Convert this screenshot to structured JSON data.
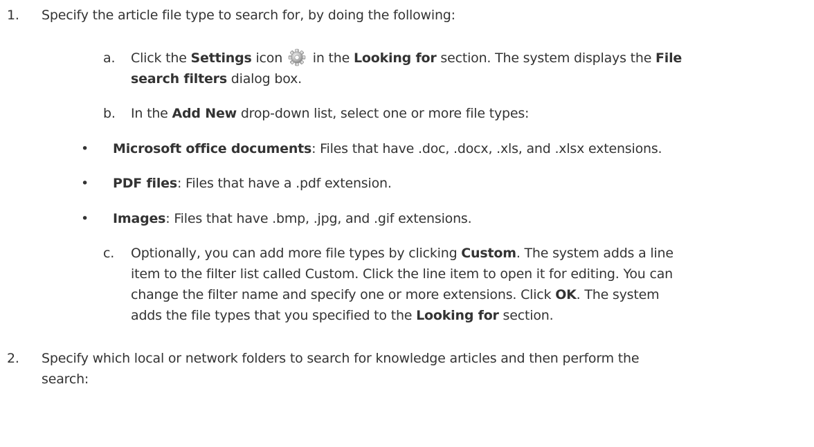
{
  "steps": [
    {
      "number": "1.",
      "text": "Specify the article file type to search for, by doing the following:",
      "substeps": [
        {
          "letter": "a.",
          "line1_pre": "Click the ",
          "settings": "Settings",
          "line1_mid": " icon ",
          "line1_mid2": " in the ",
          "looking_for": "Looking for",
          "line1_post": " section. The system displays the ",
          "file": "File",
          "line2_bold": "search filters",
          "line2_post": " dialog box.",
          "icon": "gear-icon"
        },
        {
          "letter": "b.",
          "pre": "In the ",
          "bold": "Add New",
          "post": " drop-down list, select one or more file types:"
        }
      ],
      "bullets": [
        {
          "bold": "Microsoft office documents",
          "text": ": Files that have .doc, .docx, .xls, and .xlsx extensions."
        },
        {
          "bold": "PDF files",
          "text": ": Files that have a .pdf extension."
        },
        {
          "bold": "Images",
          "text": ": Files that have .bmp, .jpg, and .gif extensions."
        }
      ],
      "substep_c": {
        "letter": "c.",
        "l1_pre": "Optionally, you can add more file types by clicking ",
        "l1_bold": "Custom",
        "l1_post": ". The system adds a line",
        "l2": "item to the filter list called Custom. Click the line item to open it for editing. You can",
        "l3_pre": "change the filter name and specify one or more extensions. Click ",
        "l3_bold": "OK",
        "l3_post": ". The system",
        "l4_pre": "adds the file types that you specified to the ",
        "l4_bold": "Looking for",
        "l4_post": " section."
      }
    },
    {
      "number": "2.",
      "line1": "Specify which local or network folders to search for knowledge articles and then perform the",
      "line2": "search:"
    }
  ],
  "bullet_char": "•"
}
